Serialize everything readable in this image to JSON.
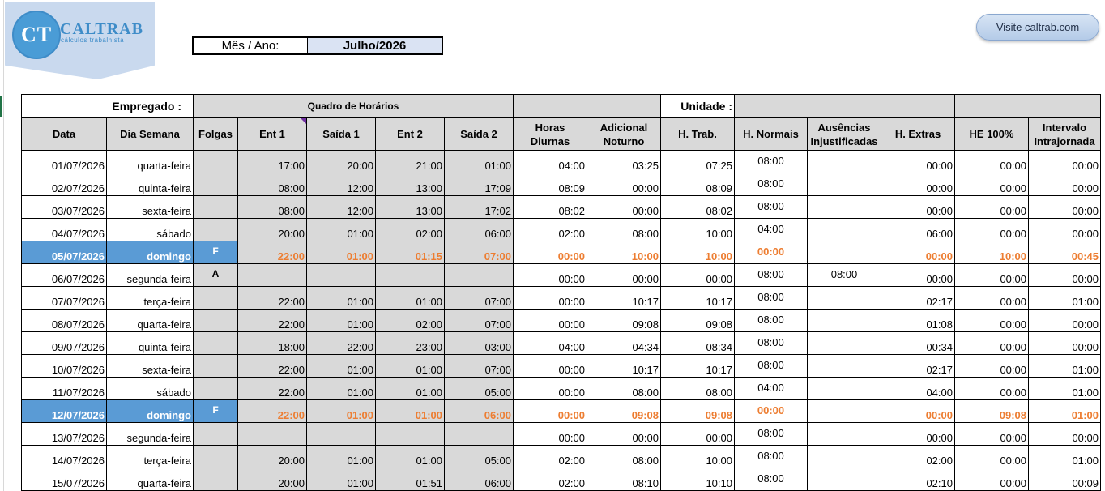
{
  "logo": {
    "initials": "CT",
    "word": "CALTRAB",
    "tagline": "cálculos trabalhista"
  },
  "month": {
    "label": "Mês / Ano:",
    "value": "Julho/2026"
  },
  "visit_button": "Visite caltrab.com",
  "top": {
    "empregado": "Empregado :",
    "quadro": "Quadro de Horários",
    "unidade": "Unidade :"
  },
  "headers": [
    "Data",
    "Dia Semana",
    "Folgas",
    "Ent 1",
    "Saída 1",
    "Ent 2",
    "Saída 2",
    "Horas Diurnas",
    "Adicional Noturno",
    "H. Trab.",
    "H. Normais",
    "Ausências Injustificadas",
    "H. Extras",
    "HE 100%",
    "Intervalo Intrajornada"
  ],
  "rows": [
    {
      "data": "01/07/2026",
      "dia": "quarta-feira",
      "folga": "",
      "ent1": "17:00",
      "sai1": "20:00",
      "ent2": "21:00",
      "sai2": "01:00",
      "diurnas": "04:00",
      "noturno": "03:25",
      "trab": "07:25",
      "normais": "08:00",
      "ausencias": "",
      "extras": "00:00",
      "he100": "00:00",
      "intervalo": "00:00"
    },
    {
      "data": "02/07/2026",
      "dia": "quinta-feira",
      "folga": "",
      "ent1": "08:00",
      "sai1": "12:00",
      "ent2": "13:00",
      "sai2": "17:09",
      "diurnas": "08:09",
      "noturno": "00:00",
      "trab": "08:09",
      "normais": "08:00",
      "ausencias": "",
      "extras": "00:00",
      "he100": "00:00",
      "intervalo": "00:00"
    },
    {
      "data": "03/07/2026",
      "dia": "sexta-feira",
      "folga": "",
      "ent1": "08:00",
      "sai1": "12:00",
      "ent2": "13:00",
      "sai2": "17:02",
      "diurnas": "08:02",
      "noturno": "00:00",
      "trab": "08:02",
      "normais": "08:00",
      "ausencias": "",
      "extras": "00:00",
      "he100": "00:00",
      "intervalo": "00:00"
    },
    {
      "data": "04/07/2026",
      "dia": "sábado",
      "folga": "",
      "ent1": "20:00",
      "sai1": "01:00",
      "ent2": "02:00",
      "sai2": "06:00",
      "diurnas": "02:00",
      "noturno": "08:00",
      "trab": "10:00",
      "normais": "04:00",
      "ausencias": "",
      "extras": "06:00",
      "he100": "00:00",
      "intervalo": "00:00"
    },
    {
      "data": "05/07/2026",
      "dia": "domingo",
      "folga": "F",
      "ent1": "22:00",
      "sai1": "01:00",
      "ent2": "01:15",
      "sai2": "07:00",
      "diurnas": "00:00",
      "noturno": "10:00",
      "trab": "10:00",
      "normais": "00:00",
      "ausencias": "",
      "extras": "00:00",
      "he100": "10:00",
      "intervalo": "00:45",
      "sunday": true
    },
    {
      "data": "06/07/2026",
      "dia": "segunda-feira",
      "folga": "A",
      "ent1": "",
      "sai1": "",
      "ent2": "",
      "sai2": "",
      "diurnas": "00:00",
      "noturno": "00:00",
      "trab": "00:00",
      "normais": "08:00",
      "ausencias": "08:00",
      "extras": "00:00",
      "he100": "00:00",
      "intervalo": "00:00"
    },
    {
      "data": "07/07/2026",
      "dia": "terça-feira",
      "folga": "",
      "ent1": "22:00",
      "sai1": "01:00",
      "ent2": "01:00",
      "sai2": "07:00",
      "diurnas": "00:00",
      "noturno": "10:17",
      "trab": "10:17",
      "normais": "08:00",
      "ausencias": "",
      "extras": "02:17",
      "he100": "00:00",
      "intervalo": "01:00"
    },
    {
      "data": "08/07/2026",
      "dia": "quarta-feira",
      "folga": "",
      "ent1": "22:00",
      "sai1": "01:00",
      "ent2": "02:00",
      "sai2": "07:00",
      "diurnas": "00:00",
      "noturno": "09:08",
      "trab": "09:08",
      "normais": "08:00",
      "ausencias": "",
      "extras": "01:08",
      "he100": "00:00",
      "intervalo": "00:00"
    },
    {
      "data": "09/07/2026",
      "dia": "quinta-feira",
      "folga": "",
      "ent1": "18:00",
      "sai1": "22:00",
      "ent2": "23:00",
      "sai2": "03:00",
      "diurnas": "04:00",
      "noturno": "04:34",
      "trab": "08:34",
      "normais": "08:00",
      "ausencias": "",
      "extras": "00:34",
      "he100": "00:00",
      "intervalo": "00:00"
    },
    {
      "data": "10/07/2026",
      "dia": "sexta-feira",
      "folga": "",
      "ent1": "22:00",
      "sai1": "01:00",
      "ent2": "01:00",
      "sai2": "07:00",
      "diurnas": "00:00",
      "noturno": "10:17",
      "trab": "10:17",
      "normais": "08:00",
      "ausencias": "",
      "extras": "02:17",
      "he100": "00:00",
      "intervalo": "01:00"
    },
    {
      "data": "11/07/2026",
      "dia": "sábado",
      "folga": "",
      "ent1": "22:00",
      "sai1": "01:00",
      "ent2": "01:00",
      "sai2": "05:00",
      "diurnas": "00:00",
      "noturno": "08:00",
      "trab": "08:00",
      "normais": "04:00",
      "ausencias": "",
      "extras": "04:00",
      "he100": "00:00",
      "intervalo": "01:00"
    },
    {
      "data": "12/07/2026",
      "dia": "domingo",
      "folga": "F",
      "ent1": "22:00",
      "sai1": "01:00",
      "ent2": "01:00",
      "sai2": "06:00",
      "diurnas": "00:00",
      "noturno": "09:08",
      "trab": "09:08",
      "normais": "00:00",
      "ausencias": "",
      "extras": "00:00",
      "he100": "09:08",
      "intervalo": "01:00",
      "sunday": true
    },
    {
      "data": "13/07/2026",
      "dia": "segunda-feira",
      "folga": "",
      "ent1": "",
      "sai1": "",
      "ent2": "",
      "sai2": "",
      "diurnas": "00:00",
      "noturno": "00:00",
      "trab": "00:00",
      "normais": "08:00",
      "ausencias": "",
      "extras": "00:00",
      "he100": "00:00",
      "intervalo": "00:00"
    },
    {
      "data": "14/07/2026",
      "dia": "terça-feira",
      "folga": "",
      "ent1": "20:00",
      "sai1": "01:00",
      "ent2": "01:00",
      "sai2": "05:00",
      "diurnas": "02:00",
      "noturno": "08:00",
      "trab": "10:00",
      "normais": "08:00",
      "ausencias": "",
      "extras": "02:00",
      "he100": "00:00",
      "intervalo": "01:00"
    },
    {
      "data": "15/07/2026",
      "dia": "quarta-feira",
      "folga": "",
      "ent1": "20:00",
      "sai1": "01:00",
      "ent2": "01:51",
      "sai2": "06:00",
      "diurnas": "02:00",
      "noturno": "08:10",
      "trab": "10:10",
      "normais": "08:00",
      "ausencias": "",
      "extras": "02:10",
      "he100": "00:00",
      "intervalo": "00:09"
    }
  ]
}
